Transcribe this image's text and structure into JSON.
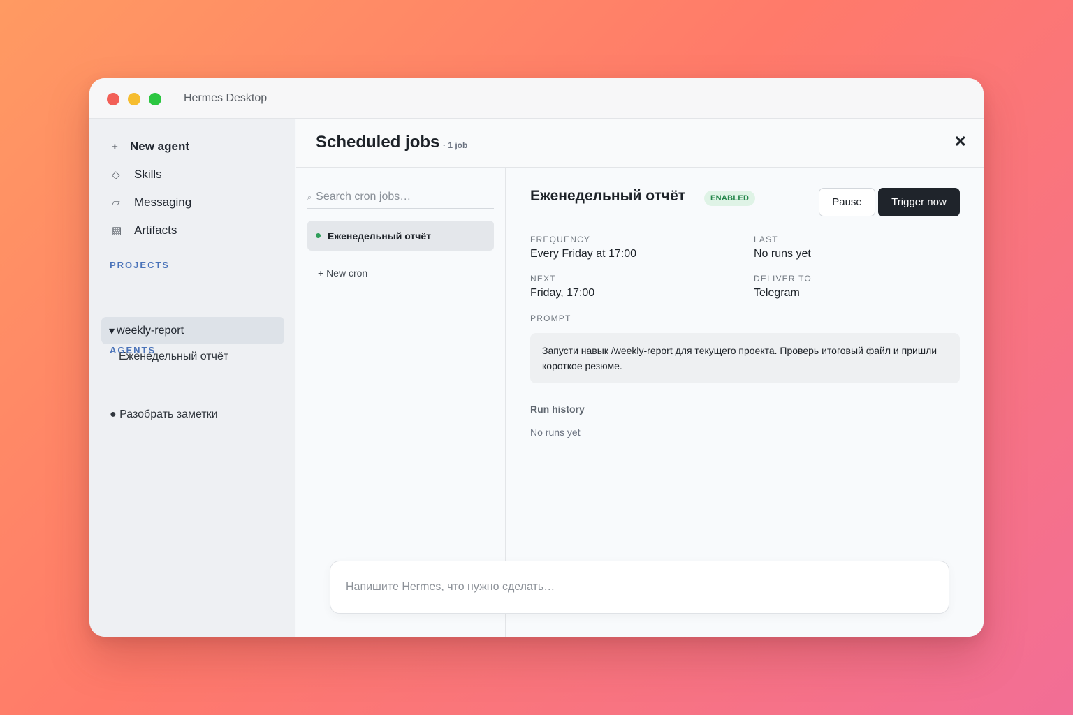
{
  "window": {
    "title": "Hermes Desktop"
  },
  "sidebar": {
    "items": [
      {
        "icon": "+",
        "label": "New agent"
      },
      {
        "icon": "◇",
        "label": "Skills"
      },
      {
        "icon": "▱",
        "label": "Messaging"
      },
      {
        "icon": "▧",
        "label": "Artifacts"
      }
    ],
    "projects_label": "PROJECTS",
    "project": {
      "caret": "▾",
      "name": "weekly-report",
      "child": "Еженедельный отчёт"
    },
    "agents_label": "AGENTS",
    "agent": "● Разобрать заметки"
  },
  "header": {
    "title": "Scheduled jobs",
    "count": "· 1 job",
    "close": "✕"
  },
  "list": {
    "search_icon": "⌕",
    "search_placeholder": "Search cron jobs…",
    "job": {
      "name": "Еженедельный отчёт",
      "status_color": "#2f9e5a"
    },
    "new_cron": "+ New cron"
  },
  "detail": {
    "title": "Еженедельный отчёт",
    "status": "ENABLED",
    "pause_label": "Pause",
    "trigger_label": "Trigger now",
    "frequency_label": "FREQUENCY",
    "frequency_value": "Every Friday at 17:00",
    "last_label": "LAST",
    "last_value": "No runs yet",
    "next_label": "NEXT",
    "next_value": "Friday, 17:00",
    "deliver_label": "DELIVER TO",
    "deliver_value": "Telegram",
    "prompt_label": "PROMPT",
    "prompt_text": "Запусти навык /weekly-report для текущего проекта. Проверь итоговый файл и пришли короткое резюме.",
    "run_history_label": "Run history",
    "run_history_empty": "No runs yet"
  },
  "composer": {
    "placeholder": "Напишите Hermes, что нужно сделать…"
  }
}
